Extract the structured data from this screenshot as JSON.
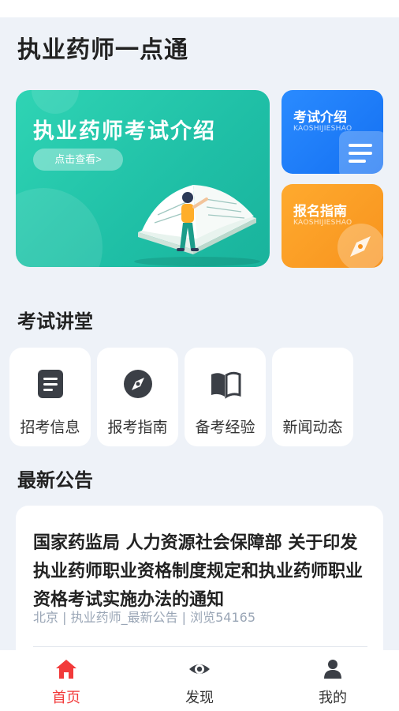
{
  "app": {
    "title": "执业药师一点通"
  },
  "hero": {
    "title": "执业药师考试介绍",
    "button_label": "点击查看>"
  },
  "cards": [
    {
      "title": "考试介绍",
      "subtitle": "KAOSHIJIESHAO",
      "color": "#1f7df7",
      "icon": "list-icon"
    },
    {
      "title": "报名指南",
      "subtitle": "KAOSHIJIESHAO",
      "color": "#f7931e",
      "icon": "compass-icon"
    }
  ],
  "lecture": {
    "title": "考试讲堂",
    "items": [
      {
        "label": "招考信息",
        "icon": "document-icon"
      },
      {
        "label": "报考指南",
        "icon": "compass-icon"
      },
      {
        "label": "备考经验",
        "icon": "book-icon"
      },
      {
        "label": "新闻动态",
        "icon": ""
      }
    ]
  },
  "announcements": {
    "title": "最新公告",
    "items": [
      {
        "title": "国家药监局 人力资源社会保障部 关于印发执业药师职业资格制度规定和执业药师职业资格考试实施办法的通知",
        "meta": "北京 | 执业药师_最新公告 | 浏览54165"
      }
    ]
  },
  "nav": {
    "active_color": "#f23a3a",
    "items": [
      {
        "label": "首页",
        "icon": "home-icon",
        "active": true
      },
      {
        "label": "发现",
        "icon": "eye-icon",
        "active": false
      },
      {
        "label": "我的",
        "icon": "user-icon",
        "active": false
      }
    ]
  }
}
